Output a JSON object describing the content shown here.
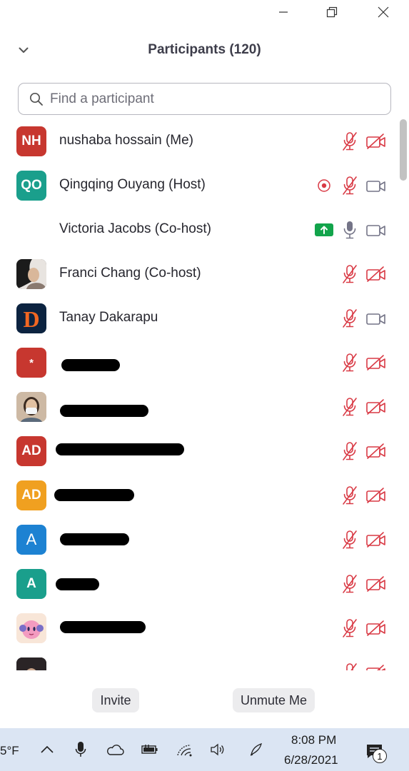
{
  "panel": {
    "title": "Participants (120)"
  },
  "search": {
    "placeholder": "Find a participant",
    "value": ""
  },
  "participants": [
    {
      "initials": "NH",
      "name": "nushaba hossain (Me)",
      "avatar_color": "#c7372f",
      "mic": "muted",
      "video": "off"
    },
    {
      "initials": "QO",
      "name": "Qingqing Ouyang (Host)",
      "avatar_color": "#1a9f8c",
      "mic": "muted",
      "video": "on",
      "recording": true
    },
    {
      "initials": "",
      "name": "Victoria Jacobs (Co-host)",
      "avatar_color": "",
      "mic": "unmuted",
      "video": "on",
      "sharing": true
    },
    {
      "initials": "",
      "name": "Franci Chang (Co-host)",
      "avatar_color": "photo",
      "mic": "muted",
      "video": "off"
    },
    {
      "initials": "",
      "name": "Tanay Dakarapu",
      "avatar_color": "#0c2340",
      "mic": "muted",
      "video": "on"
    },
    {
      "initials": "*",
      "name": "",
      "avatar_color": "#c7372f",
      "mic": "muted",
      "video": "off"
    },
    {
      "initials": "",
      "name": "",
      "avatar_color": "photo",
      "mic": "muted",
      "video": "off"
    },
    {
      "initials": "AD",
      "name": "",
      "avatar_color": "#c7372f",
      "mic": "muted",
      "video": "off"
    },
    {
      "initials": "AD",
      "name": "",
      "avatar_color": "#f0a020",
      "mic": "muted",
      "video": "off"
    },
    {
      "initials": "A",
      "name": "",
      "avatar_color": "#1d82d2",
      "mic": "muted",
      "video": "off"
    },
    {
      "initials": "A",
      "name": "",
      "avatar_color": "#1a9f8c",
      "mic": "muted",
      "video": "off"
    },
    {
      "initials": "",
      "name": "",
      "avatar_color": "photo",
      "mic": "muted",
      "video": "off"
    },
    {
      "initials": "",
      "name": "",
      "avatar_color": "photo",
      "mic": "muted",
      "video": "off"
    }
  ],
  "footer": {
    "invite_label": "Invite",
    "unmute_label": "Unmute Me"
  },
  "taskbar": {
    "weather": "5°F",
    "time": "8:08 PM",
    "date": "6/28/2021",
    "notification_count": "1"
  },
  "colors": {
    "muted_red": "#d93a45",
    "icon_gray": "#747487",
    "share_green": "#12a44b"
  }
}
